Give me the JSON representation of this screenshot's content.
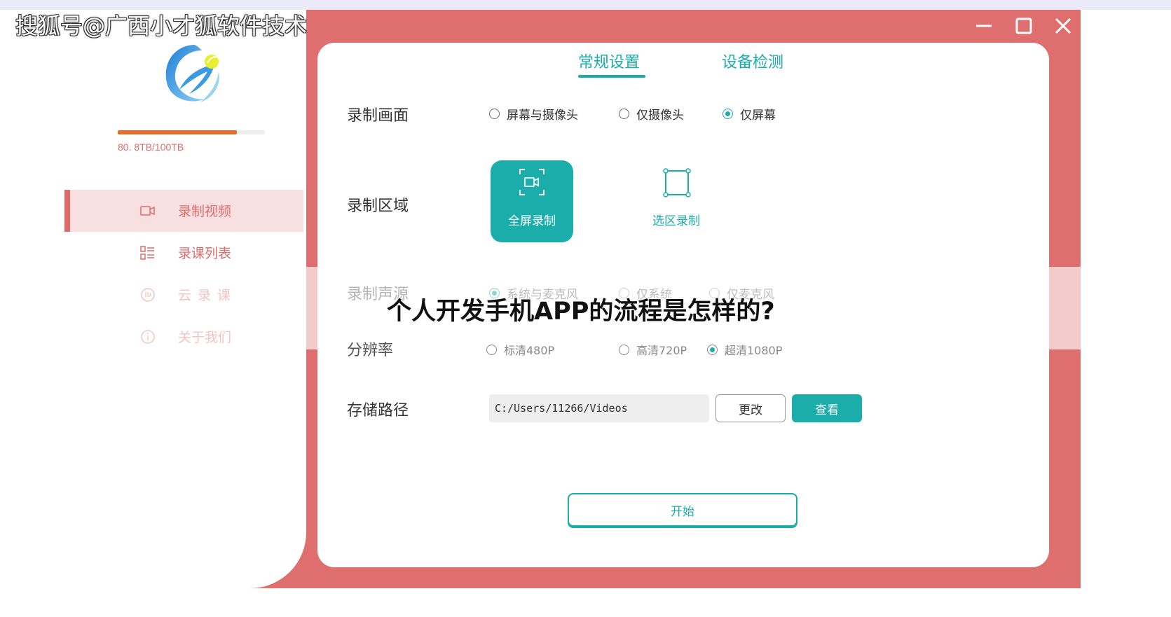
{
  "watermark": "搜狐号@广西小才狐软件技术",
  "overlay_title": "个人开发手机APP的流程是怎样的?",
  "storage": {
    "text": "80. 8TB/100TB",
    "used_fraction": 0.808
  },
  "sidebar": {
    "items": [
      {
        "label": "录制视频",
        "icon": "video-camera-icon",
        "active": true
      },
      {
        "label": "录课列表",
        "icon": "list-icon",
        "active": false
      },
      {
        "label": "云录课",
        "icon": "cloud-icon",
        "active": false
      },
      {
        "label": "关于我们",
        "icon": "info-icon",
        "active": false
      }
    ]
  },
  "tabs": [
    {
      "label": "常规设置",
      "active": true
    },
    {
      "label": "设备检测",
      "active": false
    }
  ],
  "settings": {
    "record_screen": {
      "label": "录制画面",
      "options": [
        "屏幕与摄像头",
        "仅摄像头",
        "仅屏幕"
      ],
      "selected": "仅屏幕"
    },
    "record_area": {
      "label": "录制区域",
      "full_label": "全屏录制",
      "select_label": "选区录制"
    },
    "record_audio": {
      "label": "录制声源",
      "options": [
        "系统与麦克风",
        "仅系统",
        "仅麦克风"
      ],
      "selected": "系统与麦克风"
    },
    "resolution": {
      "label": "分辨率",
      "options": [
        "标清480P",
        "高清720P",
        "超清1080P"
      ],
      "selected": "超清1080P"
    },
    "storage_path": {
      "label": "存储路径",
      "value": "C:/Users/11266/Videos",
      "change_label": "更改",
      "view_label": "查看"
    }
  },
  "start_label": "开始",
  "colors": {
    "accent": "#1aadaa",
    "frame": "#df6f6e",
    "sidebar_text": "#e06b6b"
  }
}
